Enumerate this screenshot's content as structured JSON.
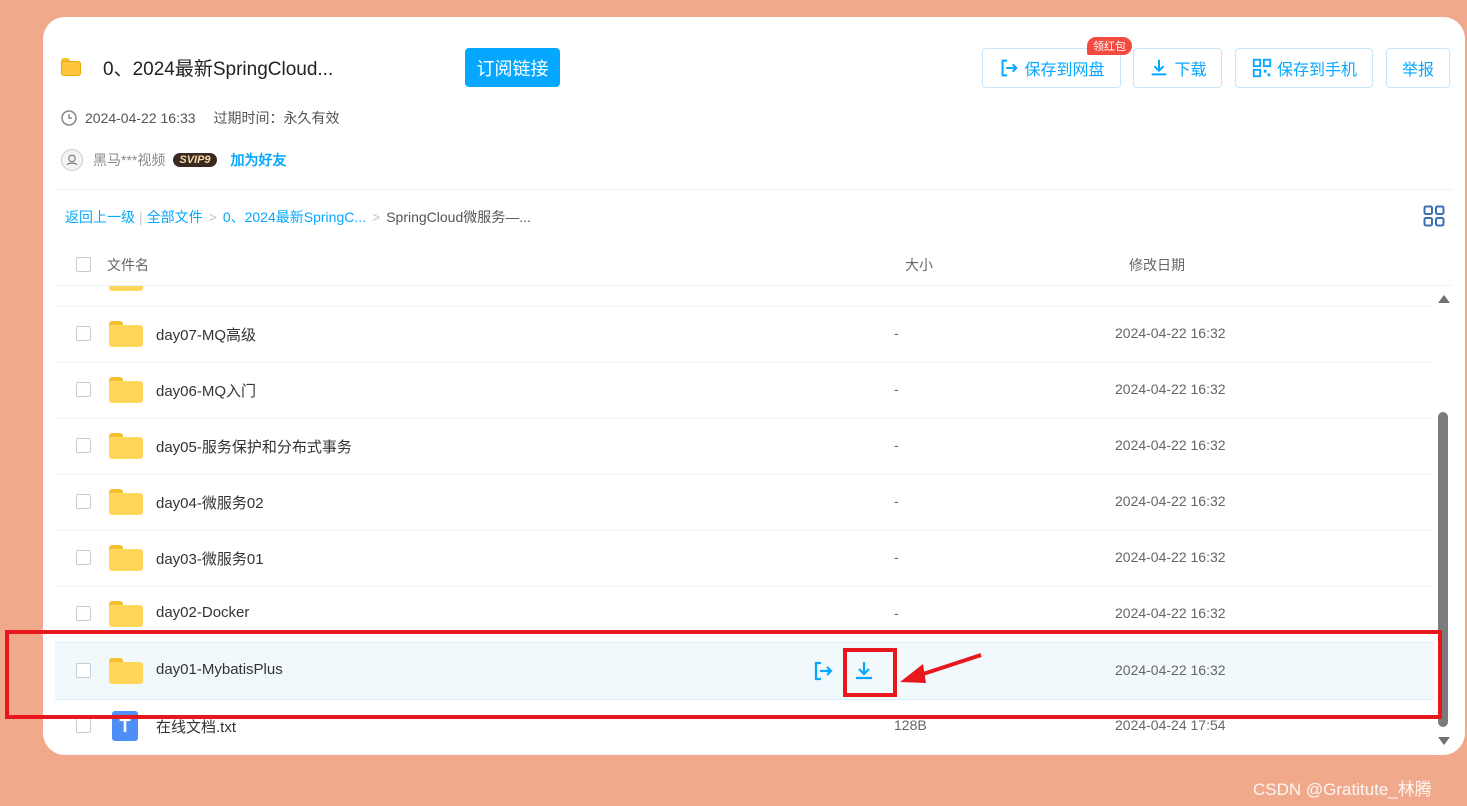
{
  "header": {
    "title": "0、2024最新SpringCloud...",
    "subscribe_label": "订阅链接",
    "save_to_disk_label": "保存到网盘",
    "redpack_badge": "领红包",
    "download_label": "下载",
    "save_to_phone_label": "保存到手机",
    "report_label": "举报"
  },
  "meta": {
    "created": "2024-04-22 16:33",
    "expire": "过期时间：永久有效"
  },
  "owner": {
    "name": "黑马***视频",
    "vip": "SVIP9",
    "add_friend": "加为好友"
  },
  "breadcrumb": {
    "back": "返回上一级",
    "bar": "|",
    "all_files": "全部文件",
    "sep": ">",
    "parent": "0、2024最新SpringC...",
    "current": "SpringCloud微服务—..."
  },
  "list_header": {
    "name": "文件名",
    "size": "大小",
    "date": "修改日期"
  },
  "files": [
    {
      "name": "day07-MQ高级",
      "size": "-",
      "date": "2024-04-22 16:32",
      "icon": "folder-icon"
    },
    {
      "name": "day06-MQ入门",
      "size": "-",
      "date": "2024-04-22 16:32",
      "icon": "folder-icon"
    },
    {
      "name": "day05-服务保护和分布式事务",
      "size": "-",
      "date": "2024-04-22 16:32",
      "icon": "folder-icon"
    },
    {
      "name": "day04-微服务02",
      "size": "-",
      "date": "2024-04-22 16:32",
      "icon": "folder-icon"
    },
    {
      "name": "day03-微服务01",
      "size": "-",
      "date": "2024-04-22 16:32",
      "icon": "folder-icon"
    },
    {
      "name": "day02-Docker",
      "size": "-",
      "date": "2024-04-22 16:32",
      "icon": "folder-icon"
    },
    {
      "name": "day01-MybatisPlus",
      "size": "",
      "date": "2024-04-22 16:32",
      "icon": "folder-icon"
    },
    {
      "name": "在线文档.txt",
      "size": "128B",
      "date": "2024-04-24 17:54",
      "icon": "txt-file-icon",
      "icon_letter": "T"
    }
  ],
  "watermark": "CSDN @Gratitute_林腾",
  "colors": {
    "accent": "#06a7ff",
    "background": "#f0a98b",
    "annotation_red": "#e8171e",
    "folder": "#ffd659"
  }
}
